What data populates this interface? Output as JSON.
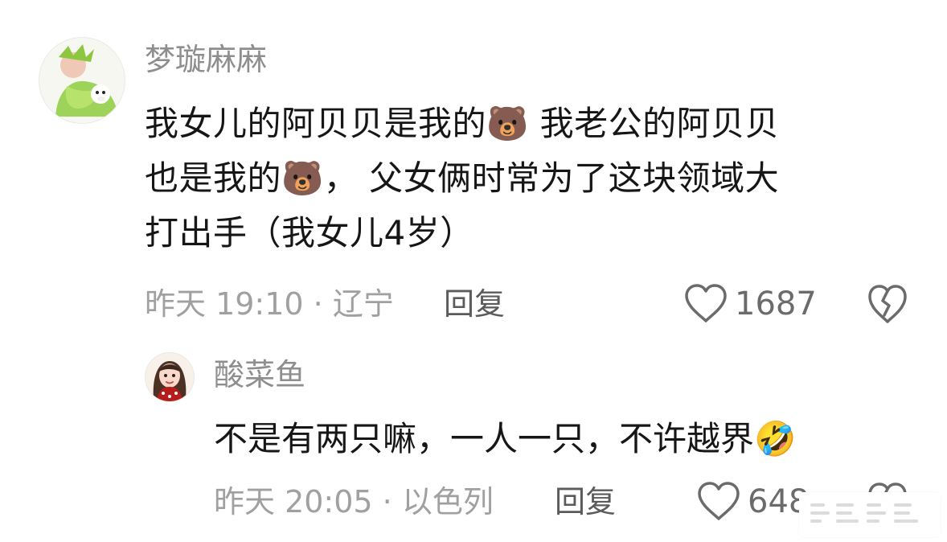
{
  "comments": [
    {
      "username": "梦璇麻麻",
      "text_lines": [
        "我女儿的阿贝贝是我的🐻  我老公的阿贝贝",
        "也是我的🐻，   父女俩时常为了这块领域大",
        "打出手（我女儿4岁）"
      ],
      "meta": "昨天 19:10 · 辽宁",
      "reply_label": "回复",
      "like_count": "1687"
    },
    {
      "username": "酸菜鱼",
      "text": "不是有两只嘛，一人一只，不许越界🤣",
      "meta": "昨天 20:05 · 以色列",
      "reply_label": "回复",
      "like_count": "648"
    }
  ],
  "colors": {
    "username": "#8e8e8e",
    "body_text": "#161616",
    "meta_text": "#a0a0a0",
    "reply_text": "#5b5b5b",
    "icon_stroke": "#6b6b6b"
  },
  "icons": {
    "like": "heart-icon",
    "dislike": "broken-heart-icon"
  }
}
